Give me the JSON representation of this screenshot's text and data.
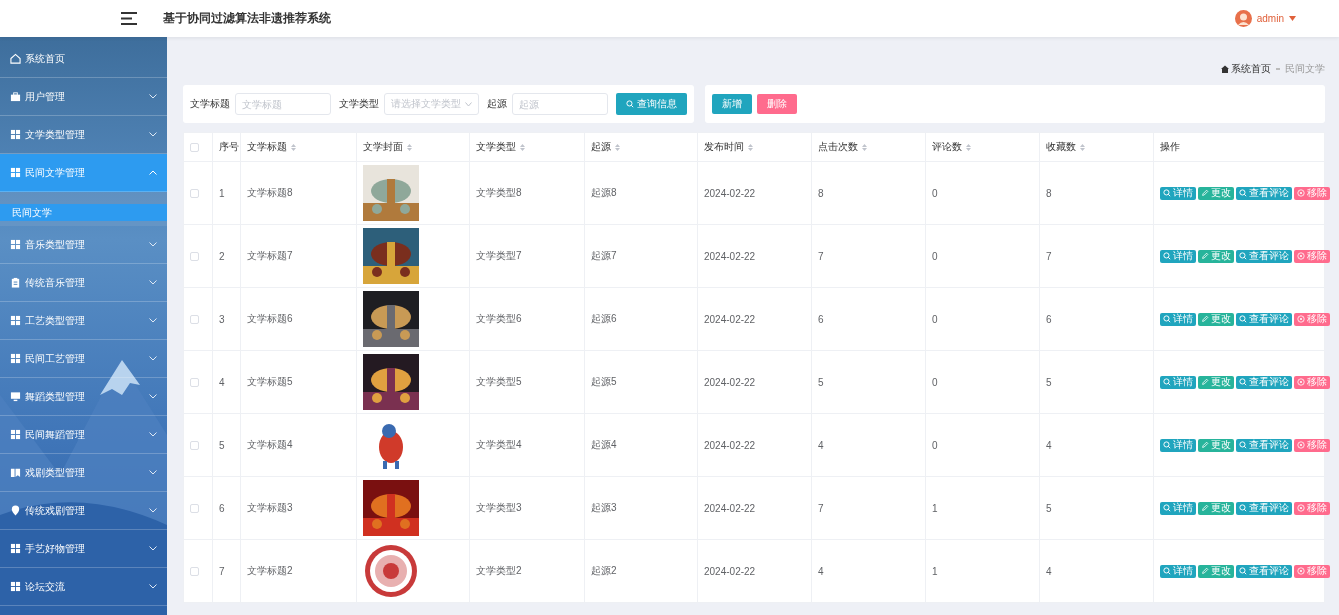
{
  "header": {
    "title": "基于协同过滤算法非遗推荐系统",
    "user": "admin"
  },
  "sidebar": {
    "items": [
      {
        "label": "系统首页",
        "kind": "home",
        "selected": false
      },
      {
        "label": "用户管理",
        "kind": "briefcase",
        "expanded": false,
        "selected": false
      },
      {
        "label": "文学类型管理",
        "kind": "grid",
        "expanded": false,
        "selected": false
      },
      {
        "label": "民间文学管理",
        "kind": "grid",
        "expanded": true,
        "selected": true,
        "children": [
          {
            "label": "民间文学",
            "selected": true
          }
        ]
      },
      {
        "label": "音乐类型管理",
        "kind": "grid",
        "expanded": false,
        "selected": false
      },
      {
        "label": "传统音乐管理",
        "kind": "clipboard",
        "expanded": false,
        "selected": false
      },
      {
        "label": "工艺类型管理",
        "kind": "grid",
        "expanded": false,
        "selected": false
      },
      {
        "label": "民间工艺管理",
        "kind": "grid",
        "expanded": false,
        "selected": false
      },
      {
        "label": "舞蹈类型管理",
        "kind": "monitor",
        "expanded": false,
        "selected": false
      },
      {
        "label": "民间舞蹈管理",
        "kind": "grid",
        "expanded": false,
        "selected": false
      },
      {
        "label": "戏剧类型管理",
        "kind": "book",
        "expanded": false,
        "selected": false
      },
      {
        "label": "传统戏剧管理",
        "kind": "pin",
        "expanded": false,
        "selected": false
      },
      {
        "label": "手艺好物管理",
        "kind": "grid",
        "expanded": false,
        "selected": false
      },
      {
        "label": "论坛交流",
        "kind": "grid",
        "expanded": false,
        "selected": false
      }
    ]
  },
  "breadcrumb": [
    "系统首页",
    "民间文学"
  ],
  "search": {
    "fields": [
      {
        "label": "文学标题",
        "placeholder": "文学标题",
        "kind": "input"
      },
      {
        "label": "文学类型",
        "placeholder": "请选择文学类型",
        "kind": "select"
      },
      {
        "label": "起源",
        "placeholder": "起源",
        "kind": "input"
      }
    ],
    "button": "查询信息"
  },
  "toolbar": [
    {
      "label": "新增",
      "kind": "add"
    },
    {
      "label": "删除",
      "kind": "delete"
    }
  ],
  "table": {
    "all_checked": false,
    "columns": [
      {
        "label": "序号",
        "sortable": false
      },
      {
        "label": "文学标题",
        "sortable": true
      },
      {
        "label": "文学封面",
        "sortable": true
      },
      {
        "label": "文学类型",
        "sortable": true
      },
      {
        "label": "起源",
        "sortable": true
      },
      {
        "label": "发布时间",
        "sortable": true
      },
      {
        "label": "点击次数",
        "sortable": true
      },
      {
        "label": "评论数",
        "sortable": true
      },
      {
        "label": "收藏数",
        "sortable": true
      },
      {
        "label": "操作",
        "sortable": false
      }
    ],
    "rows": [
      {
        "checked": false,
        "cells": [
          "1",
          "文学标题8",
          "",
          "文学类型8",
          "起源8",
          "2024-02-22",
          "8",
          "0",
          "8"
        ],
        "cover": {
          "kind": "picture"
        },
        "actions": [
          {
            "label": "详情",
            "kind": "view"
          },
          {
            "label": "更改",
            "kind": "edit"
          },
          {
            "label": "查看评论",
            "kind": "view"
          },
          {
            "label": "移除",
            "kind": "remove"
          }
        ]
      },
      {
        "checked": false,
        "cells": [
          "2",
          "文学标题7",
          "",
          "文学类型7",
          "起源7",
          "2024-02-22",
          "7",
          "0",
          "7"
        ],
        "cover": {
          "kind": "picture"
        },
        "actions": [
          {
            "label": "详情",
            "kind": "view"
          },
          {
            "label": "更改",
            "kind": "edit"
          },
          {
            "label": "查看评论",
            "kind": "view"
          },
          {
            "label": "移除",
            "kind": "remove"
          }
        ]
      },
      {
        "checked": false,
        "cells": [
          "3",
          "文学标题6",
          "",
          "文学类型6",
          "起源6",
          "2024-02-22",
          "6",
          "0",
          "6"
        ],
        "cover": {
          "kind": "picture"
        },
        "actions": [
          {
            "label": "详情",
            "kind": "view"
          },
          {
            "label": "更改",
            "kind": "edit"
          },
          {
            "label": "查看评论",
            "kind": "view"
          },
          {
            "label": "移除",
            "kind": "remove"
          }
        ]
      },
      {
        "checked": false,
        "cells": [
          "4",
          "文学标题5",
          "",
          "文学类型5",
          "起源5",
          "2024-02-22",
          "5",
          "0",
          "5"
        ],
        "cover": {
          "kind": "picture"
        },
        "actions": [
          {
            "label": "详情",
            "kind": "view"
          },
          {
            "label": "更改",
            "kind": "edit"
          },
          {
            "label": "查看评论",
            "kind": "view"
          },
          {
            "label": "移除",
            "kind": "remove"
          }
        ]
      },
      {
        "checked": false,
        "cells": [
          "5",
          "文学标题4",
          "",
          "文学类型4",
          "起源4",
          "2024-02-22",
          "4",
          "0",
          "4"
        ],
        "cover": {
          "kind": "picture"
        },
        "actions": [
          {
            "label": "详情",
            "kind": "view"
          },
          {
            "label": "更改",
            "kind": "edit"
          },
          {
            "label": "查看评论",
            "kind": "view"
          },
          {
            "label": "移除",
            "kind": "remove"
          }
        ]
      },
      {
        "checked": false,
        "cells": [
          "6",
          "文学标题3",
          "",
          "文学类型3",
          "起源3",
          "2024-02-22",
          "7",
          "1",
          "5"
        ],
        "cover": {
          "kind": "picture"
        },
        "actions": [
          {
            "label": "详情",
            "kind": "view"
          },
          {
            "label": "更改",
            "kind": "edit"
          },
          {
            "label": "查看评论",
            "kind": "view"
          },
          {
            "label": "移除",
            "kind": "remove"
          }
        ]
      },
      {
        "checked": false,
        "cells": [
          "7",
          "文学标题2",
          "",
          "文学类型2",
          "起源2",
          "2024-02-22",
          "4",
          "1",
          "4"
        ],
        "cover": {
          "kind": "picture"
        },
        "actions": [
          {
            "label": "详情",
            "kind": "view"
          },
          {
            "label": "更改",
            "kind": "edit"
          },
          {
            "label": "查看评论",
            "kind": "view"
          },
          {
            "label": "移除",
            "kind": "remove"
          }
        ]
      }
    ]
  }
}
